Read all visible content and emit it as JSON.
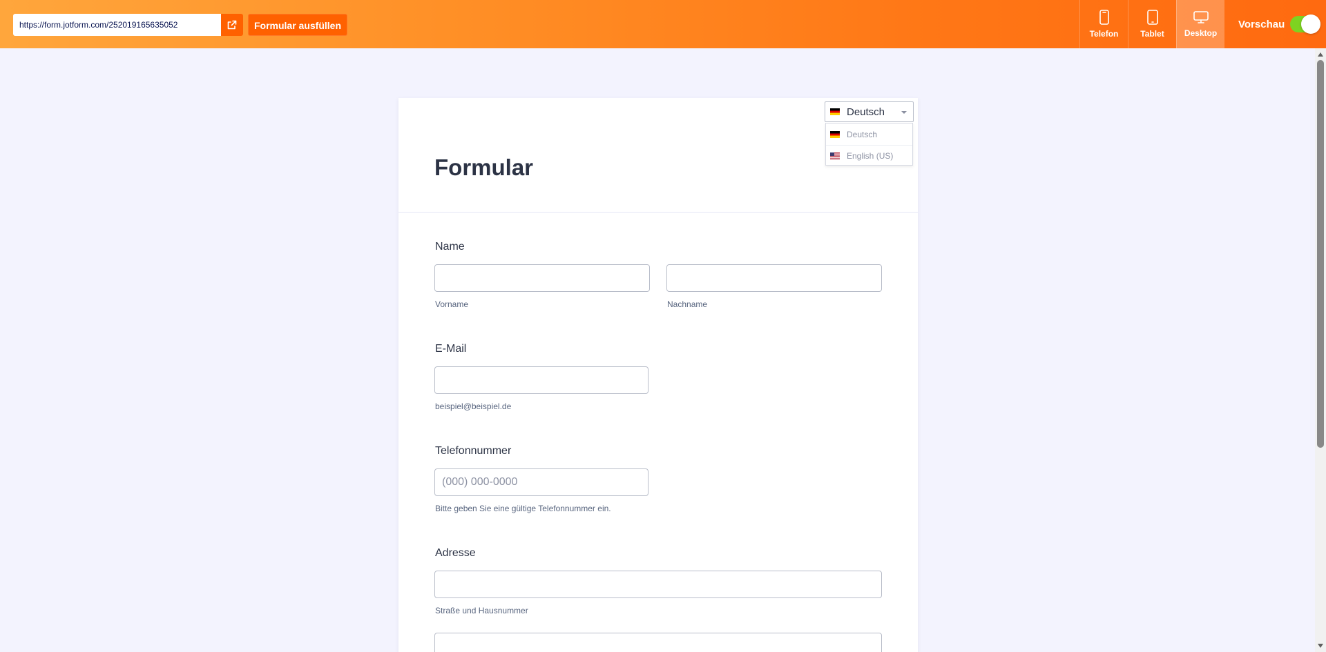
{
  "topbar": {
    "url": "https://form.jotform.com/252019165635052",
    "fill_button_label": "Formular ausfüllen",
    "devices": [
      {
        "label": "Telefon",
        "icon": "phone-icon",
        "active": false
      },
      {
        "label": "Tablet",
        "icon": "tablet-icon",
        "active": false
      },
      {
        "label": "Desktop",
        "icon": "desktop-icon",
        "active": true
      }
    ],
    "preview_label": "Vorschau",
    "preview_enabled": true
  },
  "form": {
    "title": "Formular",
    "language": {
      "selected": "Deutsch",
      "options": [
        "Deutsch",
        "English (US)"
      ]
    },
    "fields": {
      "name": {
        "label": "Name",
        "first_sublabel": "Vorname",
        "last_sublabel": "Nachname"
      },
      "email": {
        "label": "E-Mail",
        "sublabel": "beispiel@beispiel.de"
      },
      "phone": {
        "label": "Telefonnummer",
        "placeholder": "(000) 000-0000",
        "sublabel": "Bitte geben Sie eine gültige Telefonnummer ein."
      },
      "address": {
        "label": "Adresse",
        "street_sublabel": "Straße und Hausnummer"
      }
    }
  },
  "colors": {
    "brand_orange": "#ff6100",
    "toggle_on": "#7ed321",
    "page_background": "#f3f3fe"
  }
}
